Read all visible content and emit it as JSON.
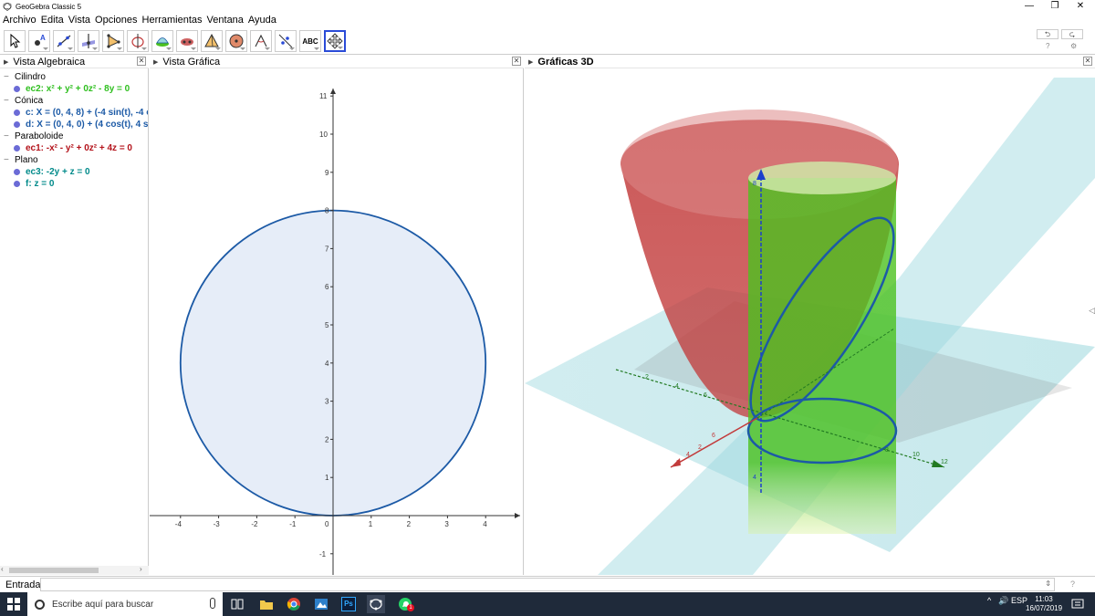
{
  "window": {
    "title": "GeoGebra Classic 5",
    "minimize": "—",
    "maximize": "❐",
    "close": "✕"
  },
  "menu": [
    "Archivo",
    "Edita",
    "Vista",
    "Opciones",
    "Herramientas",
    "Ventana",
    "Ayuda"
  ],
  "toolbar": {
    "text_tool_label": "ABC",
    "undo": "⮌",
    "redo": "⮎",
    "help_icon": "?",
    "settings_icon": "⚙"
  },
  "panels": {
    "algebra_title": "Vista Algebraica",
    "graphics_title": "Vista Gráfica",
    "graphics3d_title": "Gráficas 3D",
    "close_glyph": "✕"
  },
  "algebra": {
    "groups": [
      {
        "name": "Cilindro",
        "items": [
          {
            "text": "ec2: x² + y² + 0z² - 8y = 0",
            "color": "#2fbf1f"
          }
        ]
      },
      {
        "name": "Cónica",
        "items": [
          {
            "text": "c: X = (0, 4, 8) + (-4 sin(t), -4 c",
            "color": "#1c5aa6"
          },
          {
            "text": "d: X = (0, 4, 0) + (4 cos(t), 4 si",
            "color": "#1c5aa6"
          }
        ]
      },
      {
        "name": "Paraboloide",
        "items": [
          {
            "text": "ec1: -x² - y² + 0z² + 4z = 0",
            "color": "#b3121a"
          }
        ]
      },
      {
        "name": "Plano",
        "items": [
          {
            "text": "ec3: -2y + z = 0",
            "color": "#008a8a"
          },
          {
            "text": "f: z = 0",
            "color": "#008a8a"
          }
        ]
      }
    ]
  },
  "graphics2d": {
    "x_ticks": [
      "-4",
      "-3",
      "-2",
      "-1",
      "0",
      "1",
      "2",
      "3",
      "4"
    ],
    "y_ticks": [
      "-1",
      "1",
      "2",
      "3",
      "4",
      "5",
      "6",
      "7",
      "8",
      "9",
      "10",
      "11"
    ],
    "circle": {
      "cx": 0,
      "cy": 4,
      "r": 4
    },
    "circle_stroke": "#1c5aa6",
    "circle_fill": "#e6edf8"
  },
  "graphics3d": {
    "x_axis_labels": [
      "2",
      "4",
      "6",
      "8"
    ],
    "y_axis_labels": [
      "2",
      "4",
      "6",
      "8",
      "10",
      "12"
    ],
    "z_axis_labels": [
      "4",
      "8"
    ],
    "colors": {
      "paraboloid": "#c23b3b",
      "cylinder": "#4cc21f",
      "plane": "#9ad7dd",
      "curve": "#1c5aa6"
    }
  },
  "input": {
    "label": "Entrada:",
    "value": "",
    "help": "?"
  },
  "taskbar": {
    "search_placeholder": "Escribe aquí para buscar",
    "time": "11:03",
    "date": "16/07/2019",
    "ps_label": "Ps",
    "badge": "1",
    "tray_arrow": "^",
    "tray_speaker": "🔊",
    "tray_lang": "ESP"
  }
}
